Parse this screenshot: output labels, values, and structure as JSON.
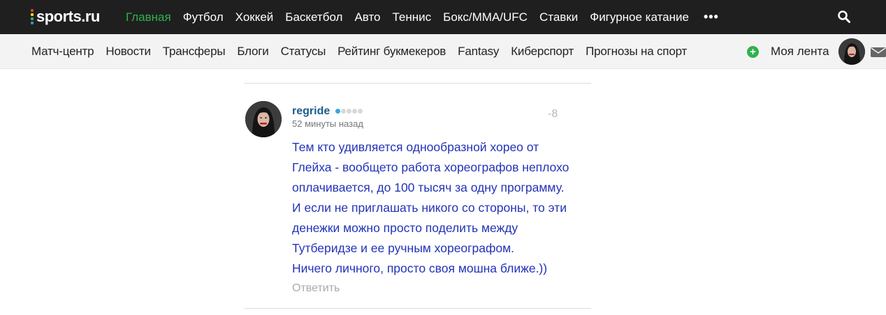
{
  "header": {
    "logo_text": "sports.ru",
    "logo_colors": [
      "#e03c3c",
      "#f2a120",
      "#f2d320",
      "#3cb34a",
      "#2f8fe0",
      "#7a4fd8"
    ],
    "main_nav": [
      {
        "label": "Главная",
        "active": true
      },
      {
        "label": "Футбол",
        "active": false
      },
      {
        "label": "Хоккей",
        "active": false
      },
      {
        "label": "Баскетбол",
        "active": false
      },
      {
        "label": "Авто",
        "active": false
      },
      {
        "label": "Теннис",
        "active": false
      },
      {
        "label": "Бокс/MMA/UFC",
        "active": false
      },
      {
        "label": "Ставки",
        "active": false
      },
      {
        "label": "Фигурное катание",
        "active": false
      }
    ],
    "more_label": "•••",
    "search_icon": "search-icon",
    "accent_color": "#2fb24c"
  },
  "subnav": {
    "items": [
      "Матч-центр",
      "Новости",
      "Трансферы",
      "Блоги",
      "Статусы",
      "Рейтинг букмекеров",
      "Fantasy",
      "Киберспорт",
      "Прогнозы на спорт"
    ],
    "plus_label": "+",
    "my_feed_label": "Моя лента",
    "avatar_icon": "user-avatar",
    "mail_icon": "mail-icon"
  },
  "comment": {
    "username": "regride",
    "rating_level": 1,
    "rating_max": 5,
    "timestamp": "52 минуты назад",
    "score": "-8",
    "lines": [
      "Тем кто удивляется однообразной хорео от",
      "Глейха - вообщето работа хореографов неплохо",
      "оплачивается, до 100 тысяч за одну программу.",
      "И если не приглашать никого со стороны, то эти",
      "денежки можно просто поделить между",
      "Тутберидзе и ее ручным хореографом.",
      "Ничего личного, просто своя мошна ближе.))"
    ],
    "reply_label": "Ответить",
    "text_color": "#2233b8",
    "username_color": "#1c5d8c"
  }
}
